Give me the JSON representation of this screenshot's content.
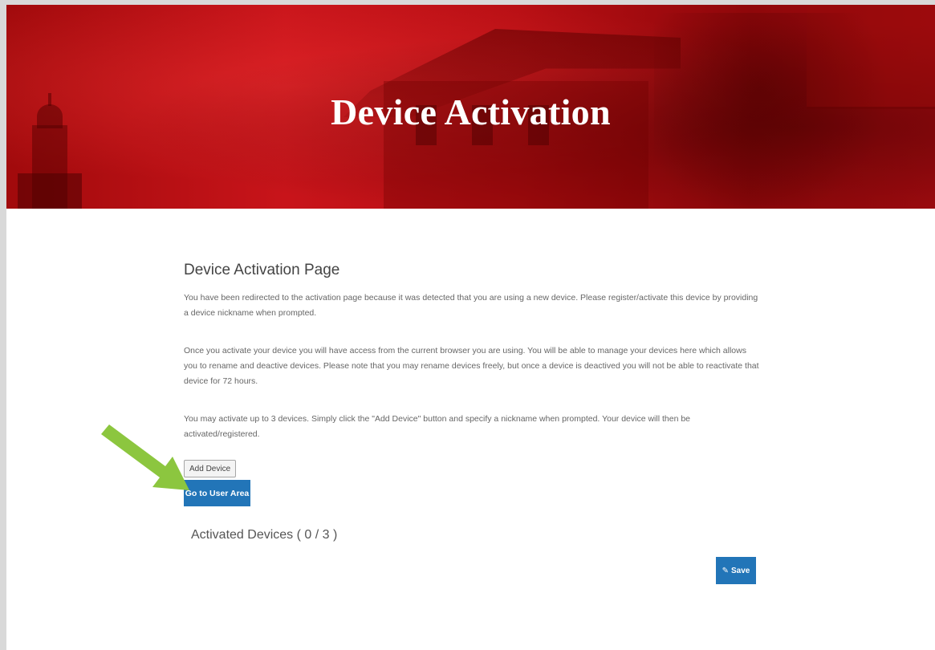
{
  "hero": {
    "title": "Device Activation"
  },
  "main": {
    "heading": "Device Activation Page",
    "paragraphs": [
      "You have been redirected to the activation page because it was detected that you are using a new device. Please register/activate this device by providing a device nickname when prompted.",
      "Once you activate your device you will have access from the current browser you are using. You will be able to manage your devices here which allows you to rename and deactive devices. Please note that you may rename devices freely, but once a device is deactived you will not be able to reactivate that device for 72 hours.",
      "You may activate up to 3 devices. Simply click the \"Add Device\" button and specify a nickname when prompted. Your device will then be activated/registered."
    ]
  },
  "buttons": {
    "add_device": "Add Device",
    "go_to_user_area": "Go to User Area",
    "save": "Save"
  },
  "devices": {
    "heading": "Activated Devices ( 0 / 3 )"
  },
  "icons": {
    "save_icon": "edit-icon",
    "annotation": "arrow-icon"
  },
  "colors": {
    "hero_red": "#c8141a",
    "button_blue": "#2275b8",
    "arrow_green": "#8cc63f"
  }
}
